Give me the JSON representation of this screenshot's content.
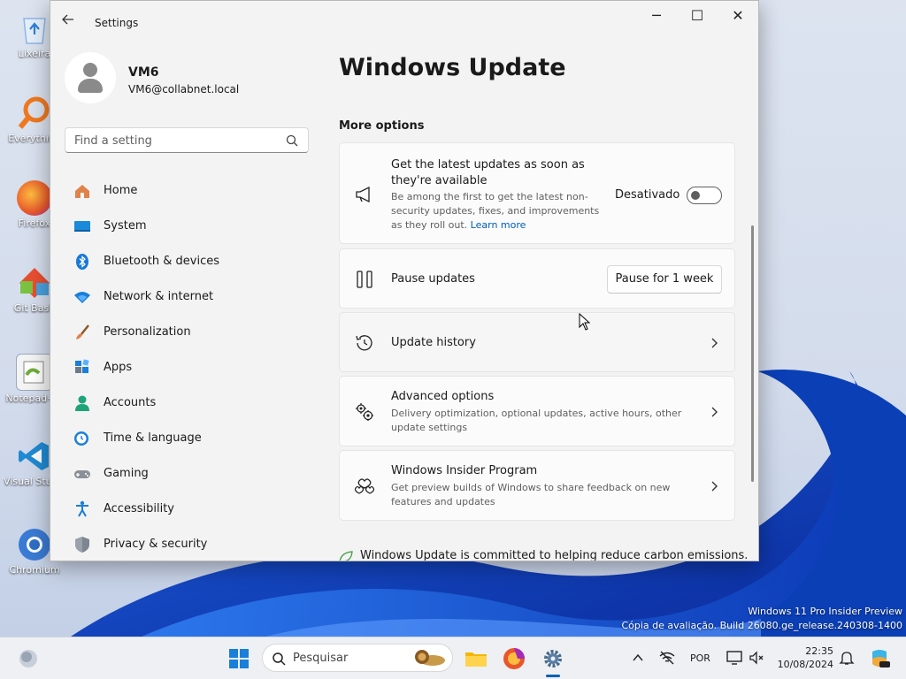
{
  "desktop": {
    "icons": [
      {
        "label": "Lixeira",
        "color": "#3f7fd1"
      },
      {
        "label": "Everything",
        "color": "#f07820"
      },
      {
        "label": "Firefox",
        "color": "#e8572b"
      },
      {
        "label": "Git Bash",
        "color": "#d94b2b"
      },
      {
        "label": "Notepad++",
        "color": "#6fae3c"
      },
      {
        "label": "Visual Studio Code",
        "color": "#1f8ad2"
      },
      {
        "label": "Chromium",
        "color": "#3a7bd5"
      }
    ],
    "watermark_line1": "Windows 11 Pro Insider Preview",
    "watermark_line2": "Cópia de avaliação. Build 26080.ge_release.240308-1400"
  },
  "window": {
    "app_title": "Settings",
    "controls": {
      "minimize": "─",
      "maximize": "☐",
      "close": "✕"
    }
  },
  "profile": {
    "name": "VM6",
    "email": "VM6@collabnet.local"
  },
  "search": {
    "placeholder": "Find a setting"
  },
  "nav": [
    {
      "label": "Home",
      "icon": "home-icon"
    },
    {
      "label": "System",
      "icon": "system-icon"
    },
    {
      "label": "Bluetooth & devices",
      "icon": "bluetooth-icon"
    },
    {
      "label": "Network & internet",
      "icon": "wifi-icon"
    },
    {
      "label": "Personalization",
      "icon": "brush-icon"
    },
    {
      "label": "Apps",
      "icon": "apps-icon"
    },
    {
      "label": "Accounts",
      "icon": "accounts-icon"
    },
    {
      "label": "Time & language",
      "icon": "clock-globe-icon"
    },
    {
      "label": "Gaming",
      "icon": "gamepad-icon"
    },
    {
      "label": "Accessibility",
      "icon": "accessibility-icon"
    },
    {
      "label": "Privacy & security",
      "icon": "shield-icon"
    }
  ],
  "main": {
    "page_title": "Windows Update",
    "section_title": "More options",
    "latest_updates": {
      "title_line1": "Get the latest updates as soon as",
      "title_line2": "they're available",
      "desc_line1": "Be among the first to get the latest non-",
      "desc_line2": "security updates, fixes, and improvements",
      "desc_line3": "as they roll out.",
      "learn_more": "Learn more",
      "toggle_label": "Desativado",
      "toggle_on": false
    },
    "pause": {
      "title": "Pause updates",
      "button": "Pause for 1 week"
    },
    "history": {
      "title": "Update history"
    },
    "advanced": {
      "title": "Advanced options",
      "desc_line1": "Delivery optimization, optional updates, active hours, other",
      "desc_line2": "update settings"
    },
    "insider": {
      "title": "Windows Insider Program",
      "desc_line1": "Get preview builds of Windows to share feedback on new",
      "desc_line2": "features and updates"
    },
    "carbon_text": "Windows Update is committed to helping reduce carbon emissions."
  },
  "taskbar": {
    "search_placeholder": "Pesquisar",
    "language": "POR",
    "time": "22:35",
    "date": "10/08/2024",
    "accent": "#005fb8"
  }
}
